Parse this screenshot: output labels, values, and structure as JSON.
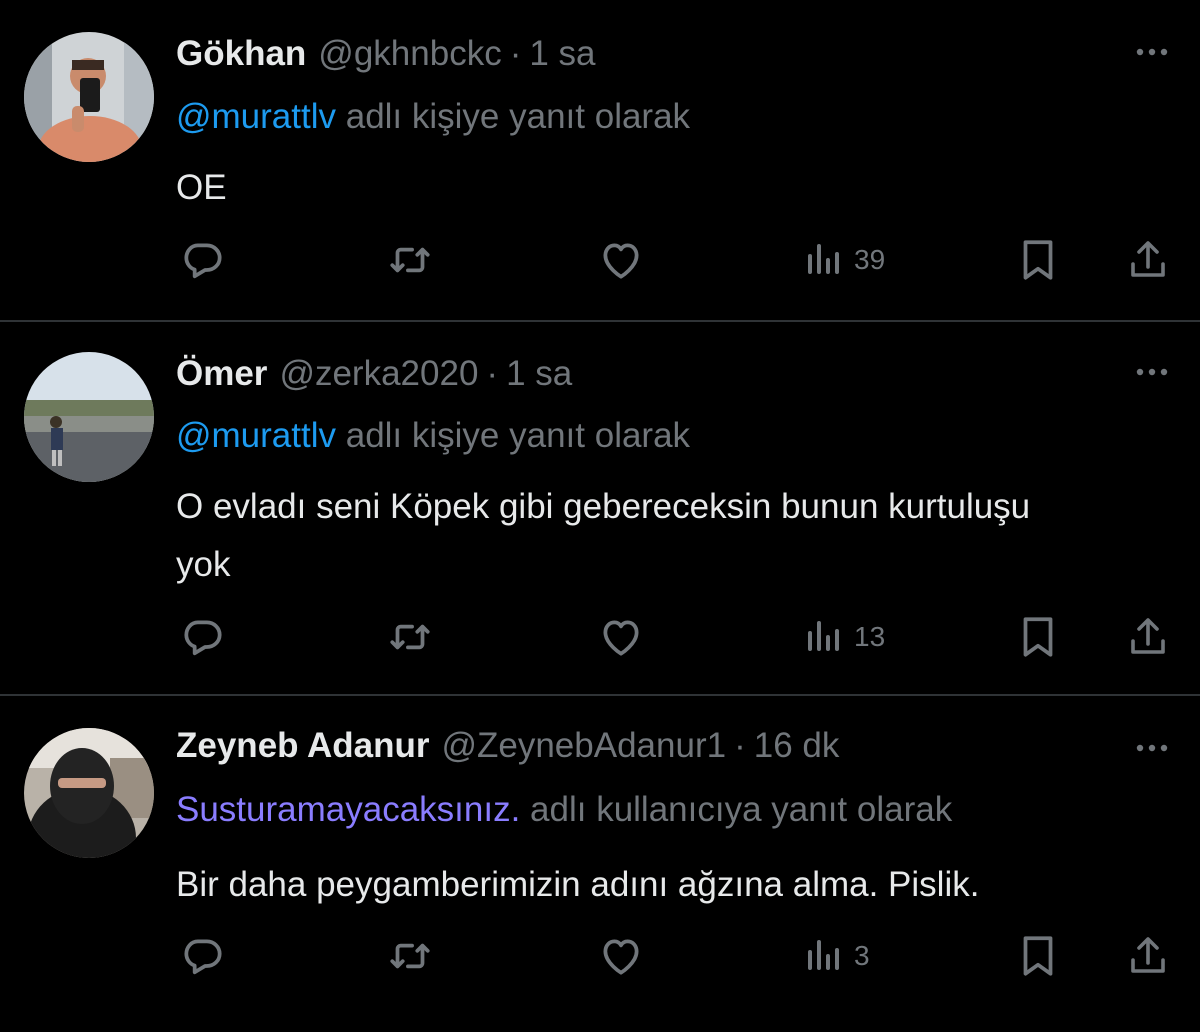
{
  "tweets": [
    {
      "name": "Gökhan",
      "handle": "@gkhnbckc",
      "separator": "·",
      "time": "1 sa",
      "reply_mention": "@murattlv",
      "reply_suffix": " adlı kişiye yanıt olarak",
      "text": "OE",
      "views": "39",
      "mention_color": "#1d9bf0"
    },
    {
      "name": "Ömer",
      "handle": "@zerka2020",
      "separator": "·",
      "time": "1 sa",
      "reply_mention": "@murattlv",
      "reply_suffix": " adlı kişiye yanıt olarak",
      "text": "O evladı seni Köpek gibi gebereceksin bunun kurtuluşu yok",
      "views": "13",
      "mention_color": "#1d9bf0"
    },
    {
      "name": "Zeyneb Adanur",
      "handle": "@ZeynebAdanur1",
      "separator": "·",
      "time": "16 dk",
      "reply_mention": "Susturamayacaksınız.",
      "reply_suffix": " adlı kullanıcıya yanıt olarak",
      "text": "Bir daha peygamberimizin adını ağzına alma. Pislik.",
      "views": "3",
      "mention_color": "#8a7dff"
    }
  ],
  "icons": {
    "reply": "reply-icon",
    "retweet": "retweet-icon",
    "like": "heart-icon",
    "views": "views-icon",
    "bookmark": "bookmark-icon",
    "share": "share-icon",
    "more": "more-icon"
  },
  "colors": {
    "background": "#000000",
    "text": "#e7e9ea",
    "muted": "#71767b",
    "link": "#1d9bf0",
    "divider": "#2f3336"
  }
}
